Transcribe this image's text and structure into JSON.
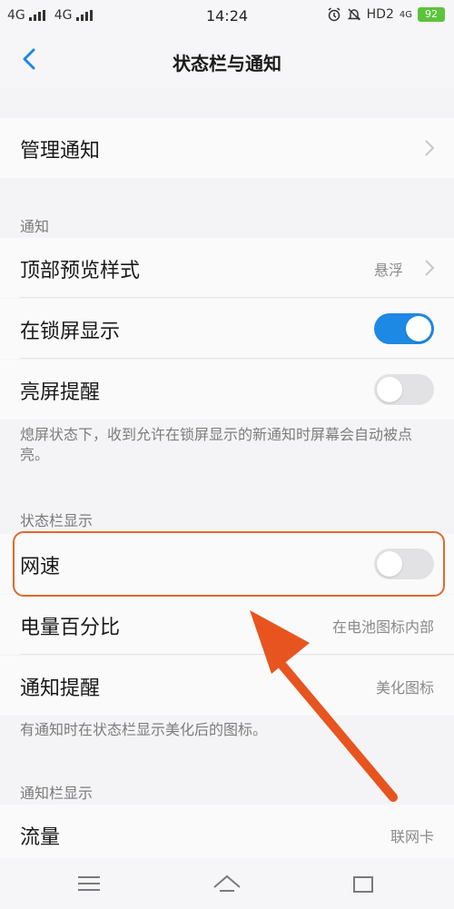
{
  "status_bar": {
    "left_signal": [
      "4G",
      "4G"
    ],
    "time": "14:24",
    "right_icons": [
      "alarm-icon",
      "mute-icon"
    ],
    "hd_text": "HD2",
    "network_text": "4G",
    "battery": "92"
  },
  "header": {
    "title": "状态栏与通知"
  },
  "rows": {
    "manage_notifications": {
      "label": "管理通知"
    },
    "notification_section": "通知",
    "top_preview_style": {
      "label": "顶部预览样式",
      "value": "悬浮"
    },
    "lockscreen_show": {
      "label": "在锁屏显示",
      "on": true
    },
    "screen_wake": {
      "label": "亮屏提醒",
      "on": false
    },
    "screen_wake_note": "熄屏状态下，收到允许在锁屏显示的新通知时屏幕会自动被点亮。",
    "statusbar_section": "状态栏显示",
    "network_speed": {
      "label": "网速",
      "on": false
    },
    "battery_percent": {
      "label": "电量百分比",
      "value": "在电池图标内部"
    },
    "notification_reminder": {
      "label": "通知提醒",
      "value": "美化图标"
    },
    "notification_reminder_note": "有通知时在状态栏显示美化后的图标。",
    "notifbar_section": "通知栏显示",
    "data_usage": {
      "label": "流量",
      "value": "联网卡"
    }
  },
  "colors": {
    "accent": "#1e88e5",
    "highlight": "#e06a2c"
  }
}
